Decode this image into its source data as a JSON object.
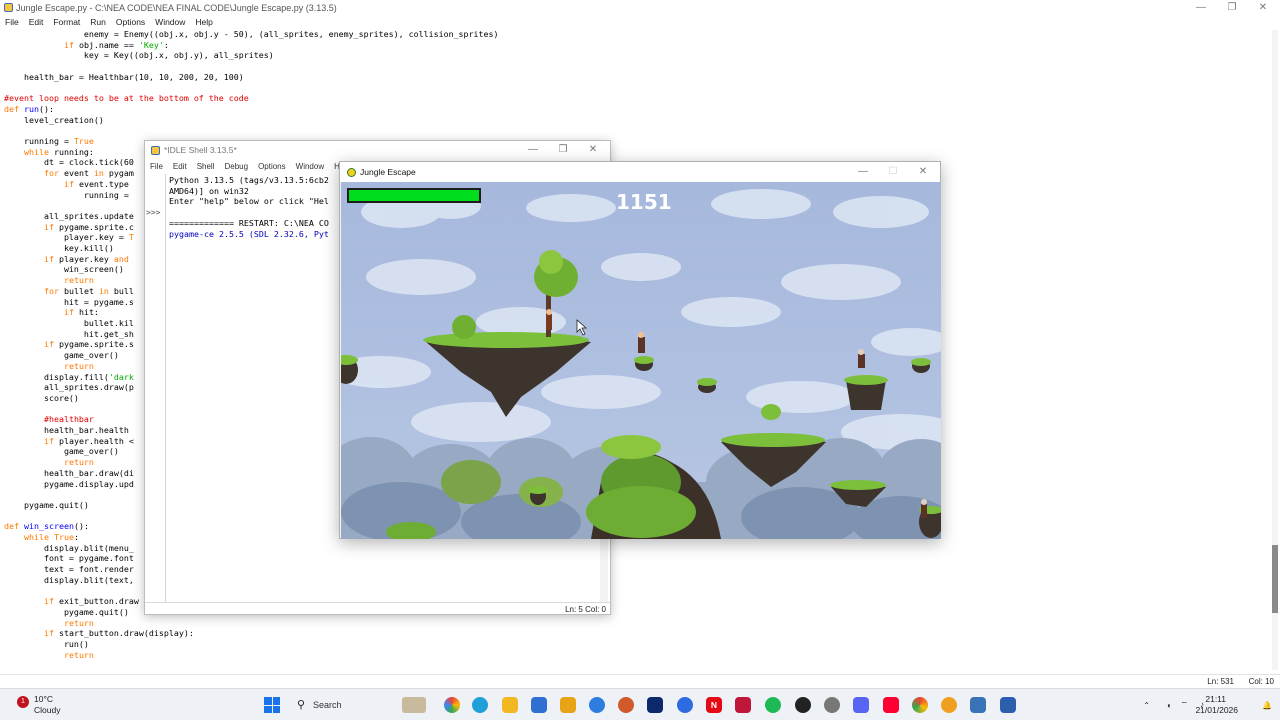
{
  "editor": {
    "title": "Jungle Escape.py - C:\\NEA CODE\\NEA FINAL CODE\\Jungle Escape.py (3.13.5)",
    "menu": [
      "File",
      "Edit",
      "Format",
      "Run",
      "Options",
      "Window",
      "Help"
    ],
    "status_line": "Ln: 531",
    "status_col": "Col: 10"
  },
  "shell": {
    "title": "*IDLE Shell 3.13.5*",
    "menu": [
      "File",
      "Edit",
      "Shell",
      "Debug",
      "Options",
      "Window",
      "Help"
    ],
    "prompt": ">>>",
    "lines": [
      "Python 3.13.5 (tags/v3.13.5:6cb2",
      "AMD64)] on win32",
      "Enter \"help\" below or click \"Hel",
      "",
      "============= RESTART: C:\\NEA CO",
      "pygame-ce 2.5.5 (SDL 2.32.6, Pyt"
    ],
    "status": "Ln: 5  Col: 0"
  },
  "game": {
    "title": "Jungle Escape",
    "score": "1151",
    "health_fraction": 1.0
  },
  "taskbar": {
    "weather_temp": "10°C",
    "weather_desc": "Cloudy",
    "search_label": "Search",
    "time": "21:11",
    "date": "21/01/2026",
    "notification_count": "1",
    "accent_green": "#00dd1e"
  }
}
